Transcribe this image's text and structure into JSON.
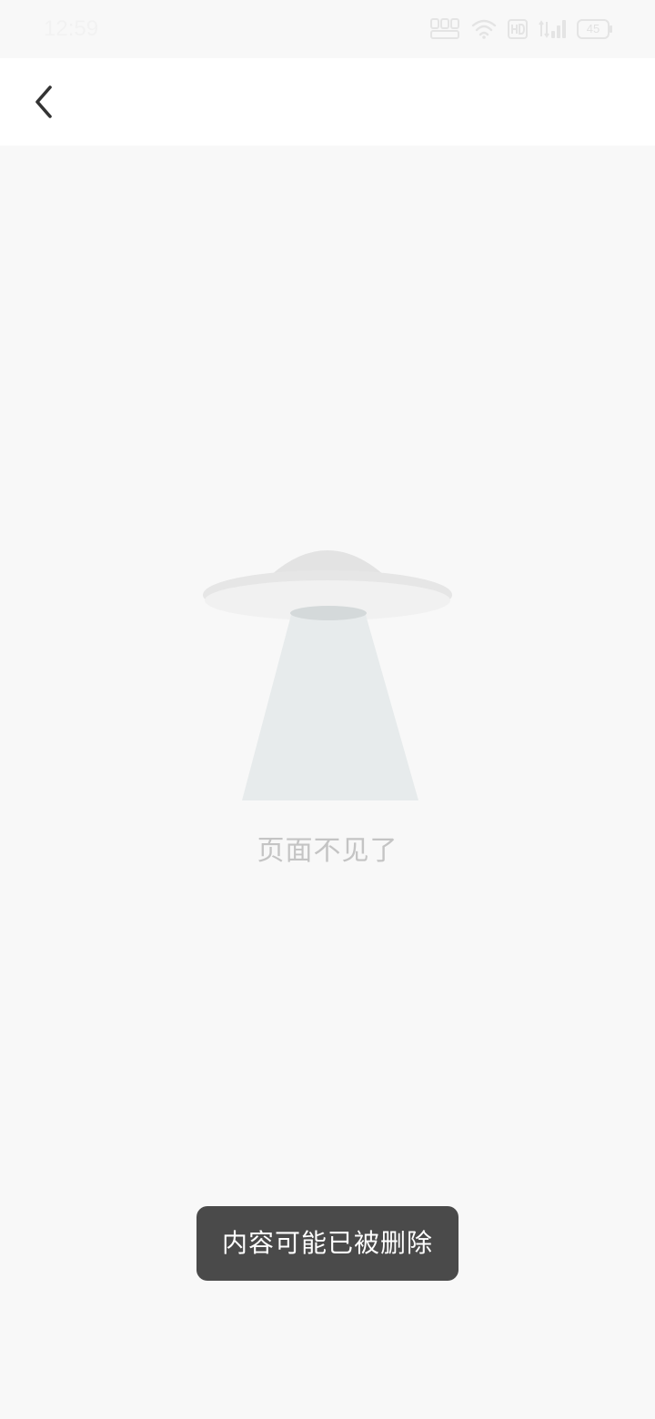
{
  "status_bar": {
    "time": "12:59",
    "battery_level": "45",
    "icons": [
      "nfc-icon",
      "wifi-icon",
      "hd-icon",
      "signal-icon",
      "battery-icon"
    ]
  },
  "top_bar": {
    "back_icon": "chevron-left-icon"
  },
  "empty_state": {
    "illustration": "ufo-icon",
    "message": "页面不见了"
  },
  "toast": {
    "message": "内容可能已被删除"
  },
  "colors": {
    "background": "#f8f8f8",
    "top_bar": "#ffffff",
    "message_text": "#c4c4c4",
    "toast_bg": "#4a4a4a",
    "toast_text": "#ffffff"
  }
}
